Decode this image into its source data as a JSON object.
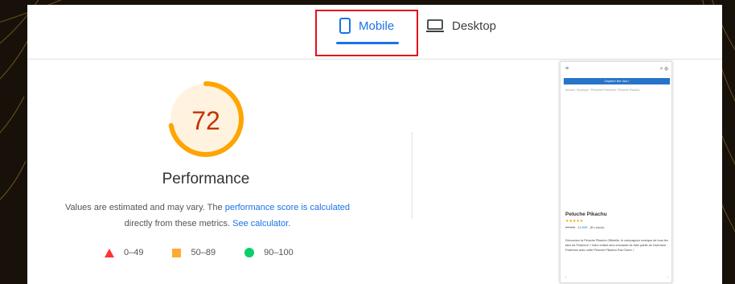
{
  "tabs": {
    "mobile_label": "Mobile",
    "desktop_label": "Desktop"
  },
  "score": {
    "value": "72",
    "fraction": 0.72,
    "label": "Performance",
    "color": "#c33300",
    "gauge_color": "#ffa400",
    "gauge_bg": "#fff3e0"
  },
  "description": {
    "prefix": "Values are estimated and may vary. The ",
    "link1": "performance score is calculated",
    "middle": " directly from these metrics. ",
    "link2": "See calculator",
    "suffix": "."
  },
  "legend": [
    {
      "range": "0–49",
      "icon": "red-triangle-icon",
      "color": "#ff3333"
    },
    {
      "range": "50–89",
      "icon": "orange-square-icon",
      "color": "#ffaa33"
    },
    {
      "range": "90–100",
      "icon": "green-circle-icon",
      "color": "#0cce6b"
    }
  ],
  "phone": {
    "menu": "≡",
    "icons": "⌕ ⊕",
    "banner": "Capture the duo !",
    "breadcrumb": "Accueil / Boutique / Peluches Pokémon / Peluche Pikachu",
    "title": "Peluche Pikachu",
    "stars": "★★★★★",
    "old_price": "39,90€",
    "price": "24,90€",
    "note": "(En stock)",
    "desc": "Découvrez la Peluche Pikachu Officielle, le compagnon iconique de tous les fans de Pokémon ! Votre enfant sera enchanté de faire partie de l'aventure Pokémon avec cette Peluche Pikachu Pas Chère !",
    "bottom_left": "‹",
    "bottom_right": "›"
  }
}
